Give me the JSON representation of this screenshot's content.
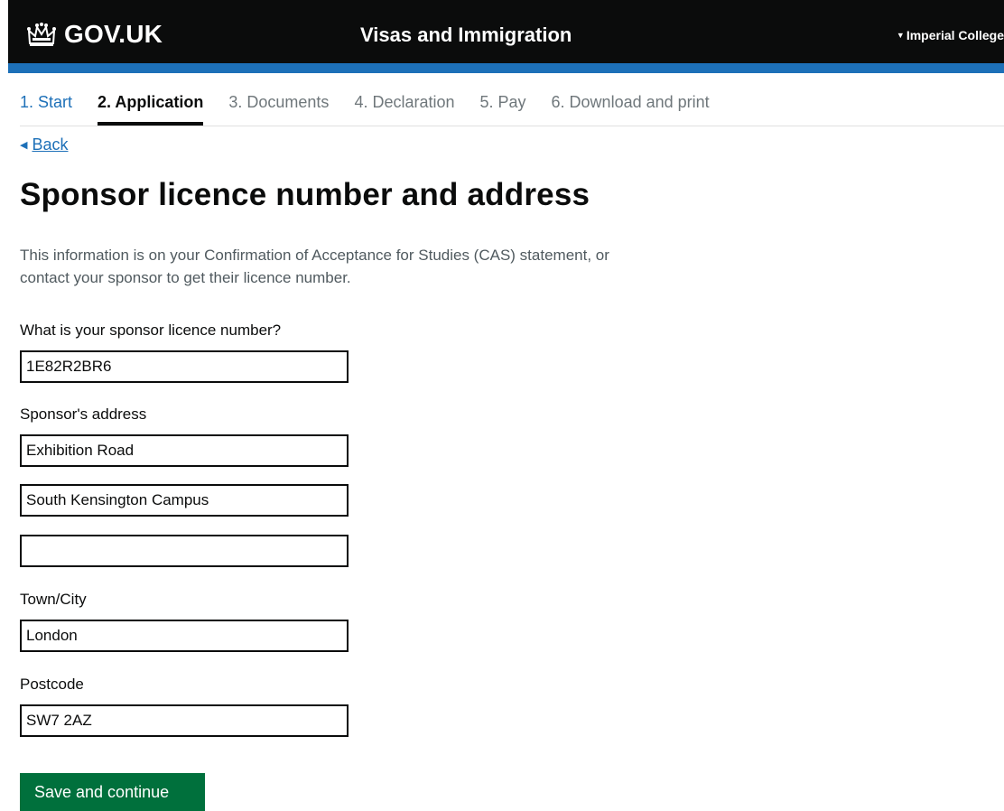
{
  "header": {
    "logo_text": "GOV.UK",
    "service_name": "Visas and Immigration",
    "account_label": "Imperial College"
  },
  "colors": {
    "header_bg": "#0b0c0c",
    "blue_strip": "#1d70b8",
    "link": "#1d70b8",
    "button_green": "#00703c"
  },
  "steps": [
    {
      "label": "1. Start",
      "state": "done"
    },
    {
      "label": "2. Application",
      "state": "current"
    },
    {
      "label": "3. Documents",
      "state": "upcoming"
    },
    {
      "label": "4. Declaration",
      "state": "upcoming"
    },
    {
      "label": "5. Pay",
      "state": "upcoming"
    },
    {
      "label": "6. Download and print",
      "state": "upcoming"
    }
  ],
  "back_link": "Back",
  "page": {
    "title": "Sponsor licence number and address",
    "hint": "This information is on your Confirmation of Acceptance for Studies (CAS) statement, or contact your sponsor to get their licence number."
  },
  "form": {
    "licence": {
      "label": "What is your sponsor licence number?",
      "value": "1E82R2BR6"
    },
    "address": {
      "label": "Sponsor's address",
      "line1": "Exhibition Road",
      "line2": "South Kensington Campus",
      "line3": ""
    },
    "town": {
      "label": "Town/City",
      "value": "London"
    },
    "postcode": {
      "label": "Postcode",
      "value": "SW7 2AZ"
    },
    "submit_label": "Save and continue"
  }
}
